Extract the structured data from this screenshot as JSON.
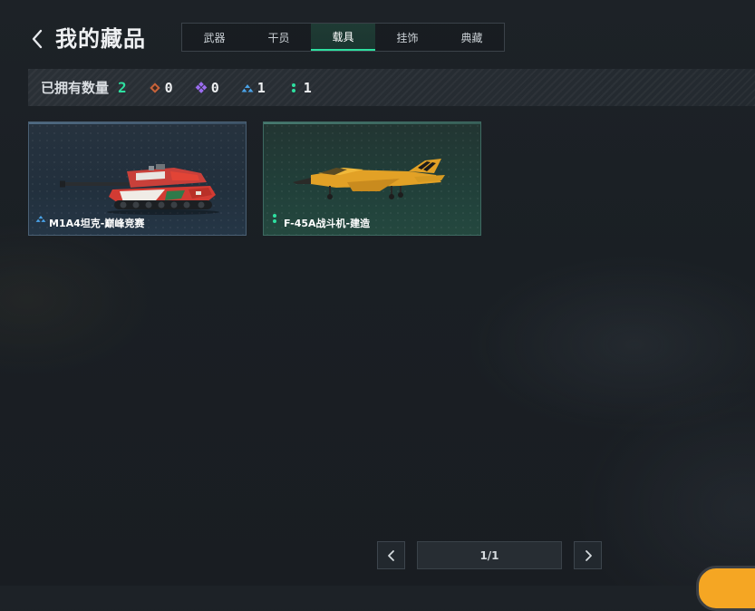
{
  "header": {
    "title": "我的藏品",
    "back_icon": "chevron-left-icon"
  },
  "tabs": [
    {
      "label": "武器",
      "active": false
    },
    {
      "label": "干员",
      "active": false
    },
    {
      "label": "载具",
      "active": true
    },
    {
      "label": "挂饰",
      "active": false
    },
    {
      "label": "典藏",
      "active": false
    }
  ],
  "stats": {
    "owned_label": "已拥有数量",
    "owned_total": "2",
    "rarities": [
      {
        "icon": "orange-diamond-icon",
        "color": "#e0784a",
        "count": "0"
      },
      {
        "icon": "purple-diamond-icon",
        "color": "#9b6cf0",
        "count": "0"
      },
      {
        "icon": "blue-triangle-icon",
        "color": "#4aa3e8",
        "count": "1"
      },
      {
        "icon": "green-dots-icon",
        "color": "#2ee0a0",
        "count": "1"
      }
    ]
  },
  "items": [
    {
      "name": "M1A4坦克-巅峰竞赛",
      "rarity_icon": "blue-triangle-icon",
      "rarity_color": "#4aa3e8",
      "theme": "blue"
    },
    {
      "name": "F-45A战斗机-建造",
      "rarity_icon": "green-dots-icon",
      "rarity_color": "#2ee0a0",
      "theme": "green"
    }
  ],
  "pagination": {
    "label": "1/1",
    "prev_icon": "chevron-left-icon",
    "next_icon": "chevron-right-icon"
  },
  "colors": {
    "accent": "#2ee0a0",
    "corner_button": "#f5a623"
  }
}
